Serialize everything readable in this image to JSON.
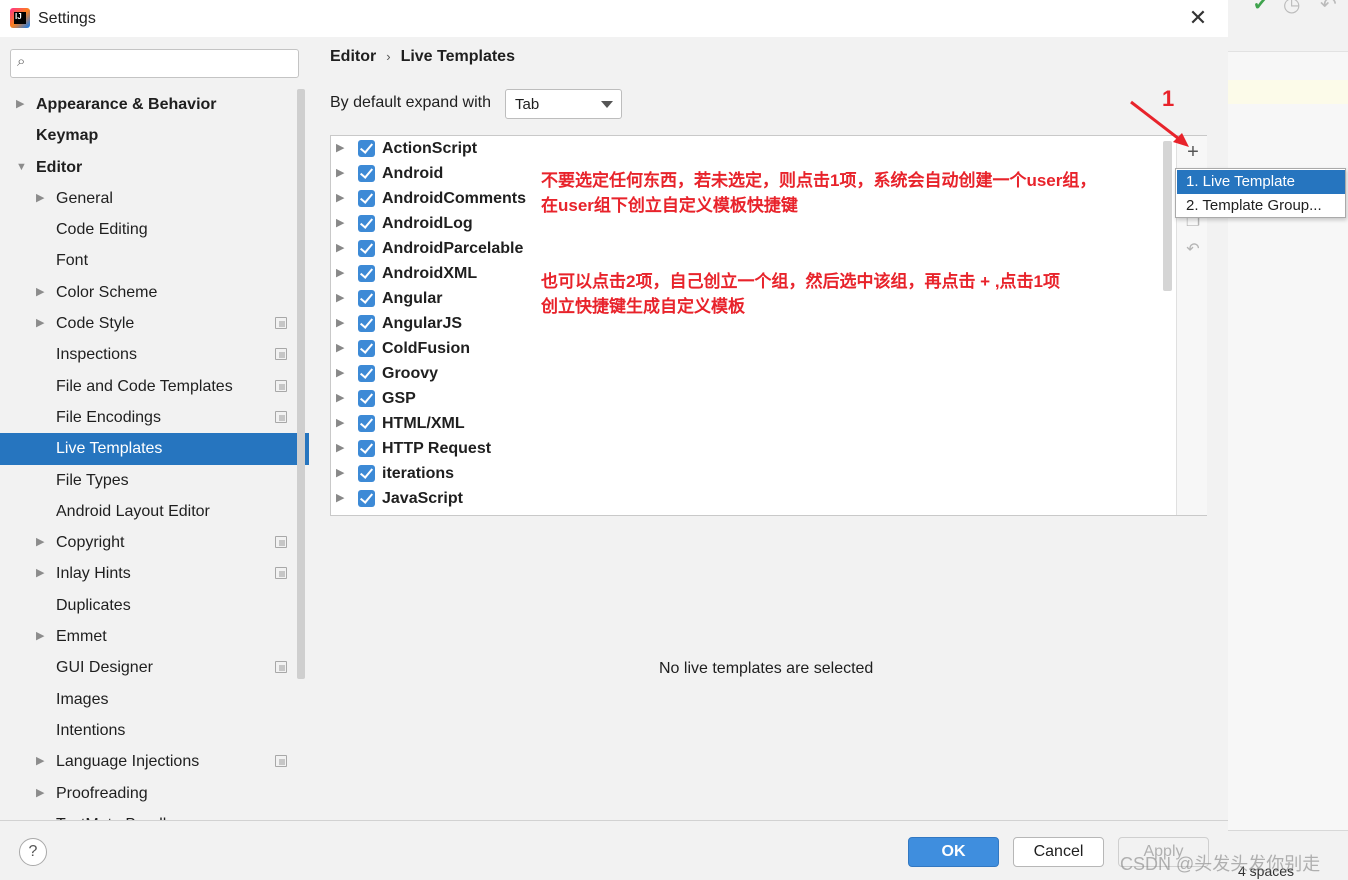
{
  "window": {
    "title": "Settings"
  },
  "search": {
    "placeholder": "",
    "value": ""
  },
  "sidebar": {
    "items": [
      {
        "label": "Appearance & Behavior",
        "level": 0,
        "bold": true,
        "expandable": true,
        "expanded": false
      },
      {
        "label": "Keymap",
        "level": 0,
        "bold": true,
        "expandable": false
      },
      {
        "label": "Editor",
        "level": 0,
        "bold": true,
        "expandable": true,
        "expanded": true
      },
      {
        "label": "General",
        "level": 1,
        "expandable": true
      },
      {
        "label": "Code Editing",
        "level": 1
      },
      {
        "label": "Font",
        "level": 1
      },
      {
        "label": "Color Scheme",
        "level": 1,
        "expandable": true
      },
      {
        "label": "Code Style",
        "level": 1,
        "expandable": true,
        "project": true
      },
      {
        "label": "Inspections",
        "level": 1,
        "project": true
      },
      {
        "label": "File and Code Templates",
        "level": 1,
        "project": true
      },
      {
        "label": "File Encodings",
        "level": 1,
        "project": true
      },
      {
        "label": "Live Templates",
        "level": 1,
        "selected": true
      },
      {
        "label": "File Types",
        "level": 1
      },
      {
        "label": "Android Layout Editor",
        "level": 1
      },
      {
        "label": "Copyright",
        "level": 1,
        "expandable": true,
        "project": true
      },
      {
        "label": "Inlay Hints",
        "level": 1,
        "expandable": true,
        "project": true
      },
      {
        "label": "Duplicates",
        "level": 1
      },
      {
        "label": "Emmet",
        "level": 1,
        "expandable": true
      },
      {
        "label": "GUI Designer",
        "level": 1,
        "project": true
      },
      {
        "label": "Images",
        "level": 1
      },
      {
        "label": "Intentions",
        "level": 1
      },
      {
        "label": "Language Injections",
        "level": 1,
        "expandable": true,
        "project": true
      },
      {
        "label": "Proofreading",
        "level": 1,
        "expandable": true
      },
      {
        "label": "TextMate Bundles",
        "level": 1
      }
    ]
  },
  "breadcrumb": {
    "parent": "Editor",
    "separator": "›",
    "current": "Live Templates"
  },
  "expand": {
    "label": "By default expand with",
    "value": "Tab"
  },
  "templates": [
    "ActionScript",
    "Android",
    "AndroidComments",
    "AndroidLog",
    "AndroidParcelable",
    "AndroidXML",
    "Angular",
    "AngularJS",
    "ColdFusion",
    "Groovy",
    "GSP",
    "HTML/XML",
    "HTTP Request",
    "iterations",
    "JavaScript"
  ],
  "toolbar": {
    "add_icon": "plus-icon",
    "copy_icon": "copy-icon",
    "restore_icon": "restore-icon"
  },
  "popup": {
    "items": [
      "1. Live Template",
      "2. Template Group..."
    ]
  },
  "annotations": {
    "number": "1",
    "note1_line1": "不要选定任何东西，若未选定，则点击1项，系统会自动创建一个user组，",
    "note1_line2": "在user组下创立自定义模板快捷键",
    "note2_line1": "也可以点击2项，自己创立一个组，然后选中该组，再点击 + ,点击1项",
    "note2_line2": "创立快捷键生成自定义模板"
  },
  "empty_message": "No live templates are selected",
  "buttons": {
    "help": "?",
    "ok": "OK",
    "cancel": "Cancel",
    "apply": "Apply"
  },
  "ide": {
    "spaces": "4 spaces"
  },
  "watermark": "CSDN @头发头发你别走",
  "colors": {
    "accent": "#2675bf",
    "annotation": "#e8232b",
    "checkbox": "#3d8ad6"
  }
}
